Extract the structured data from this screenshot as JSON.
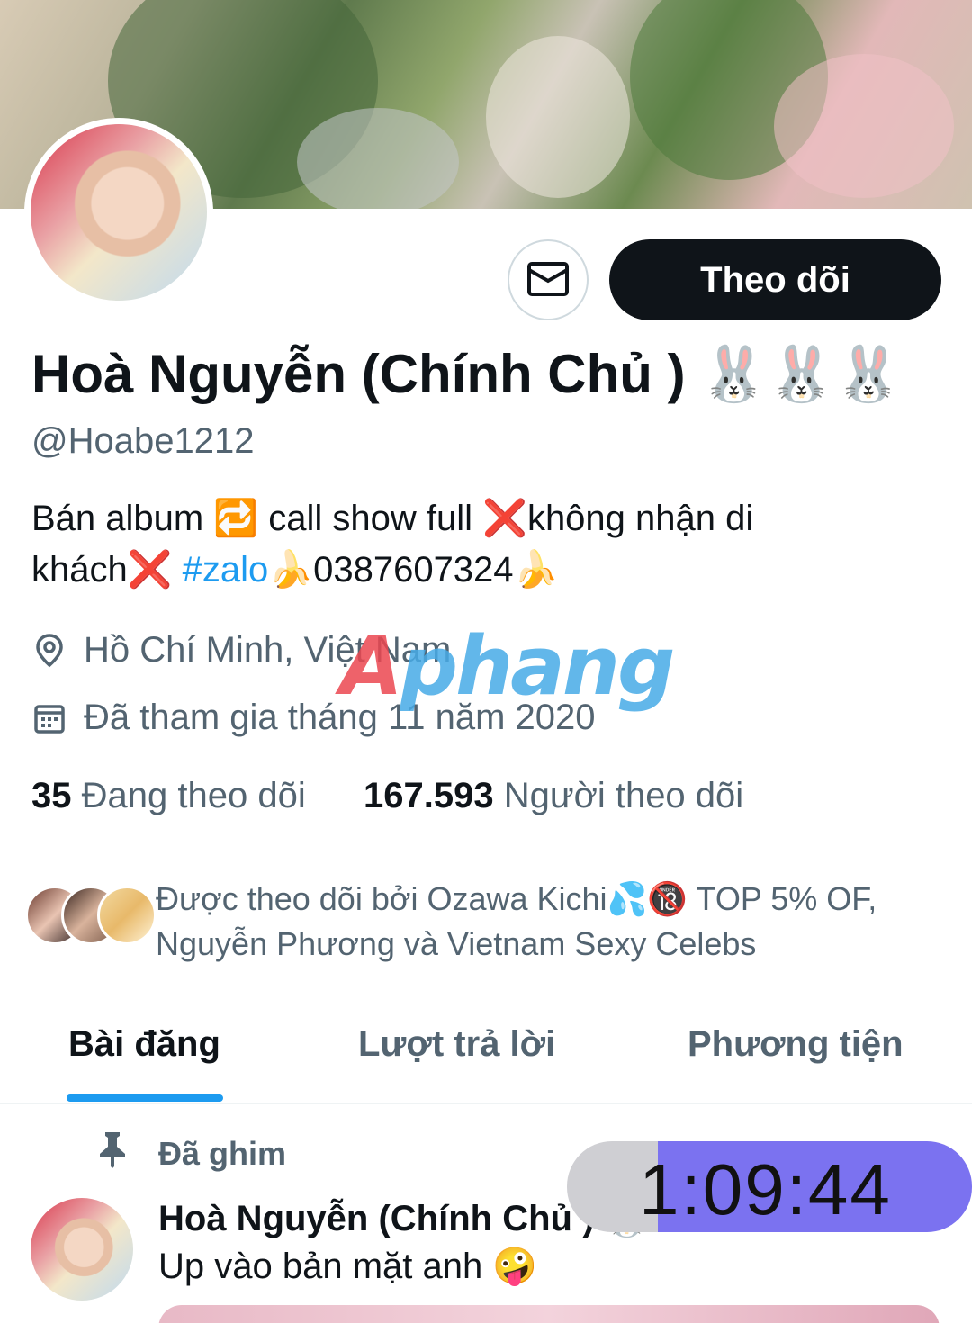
{
  "profile": {
    "name": "Hoà Nguyễn (Chính Chủ )",
    "name_emoji": "🐰🐰🐰",
    "handle": "@Hoabe1212",
    "follow_label": "Theo dõi",
    "bio_line1": "Bán album 🔁 call show full ❌không nhận di",
    "bio_line2_a": "khách❌ ",
    "bio_hashtag": "#zalo",
    "bio_line2_b": "🍌0387607324🍌",
    "location": "Hồ Chí Minh, Việt Nam",
    "joined": "Đã tham gia tháng 11 năm 2020",
    "following_count": "35",
    "following_label": "Đang theo dõi",
    "followers_count": "167.593",
    "followers_label": "Người theo dõi",
    "followed_by_line1": "Được theo dõi bởi Ozawa Kichi💦🔞 TOP 5% OF,",
    "followed_by_line2": "Nguyễn Phương và Vietnam Sexy Celebs"
  },
  "watermark": {
    "part1": "A",
    "part2": "phang"
  },
  "tabs": [
    {
      "label": "Bài đăng",
      "active": true
    },
    {
      "label": "Lượt trả lời",
      "active": false
    },
    {
      "label": "Phương tiện",
      "active": false
    }
  ],
  "pinned_post": {
    "pinned_label": "Đã ghim",
    "author": "Hoà Nguyễn (Chính Chủ ) 🐰",
    "text": "Up vào bản mặt anh 🤪"
  },
  "timer": {
    "value": "1:09:44"
  },
  "colors": {
    "accent": "#1d9bf0",
    "follow_button": "#0f1419",
    "timer_bg": "#7b72f0",
    "secondary_text": "#536471"
  },
  "icons": [
    "mail-icon",
    "location-pin-icon",
    "calendar-icon",
    "pin-icon"
  ]
}
